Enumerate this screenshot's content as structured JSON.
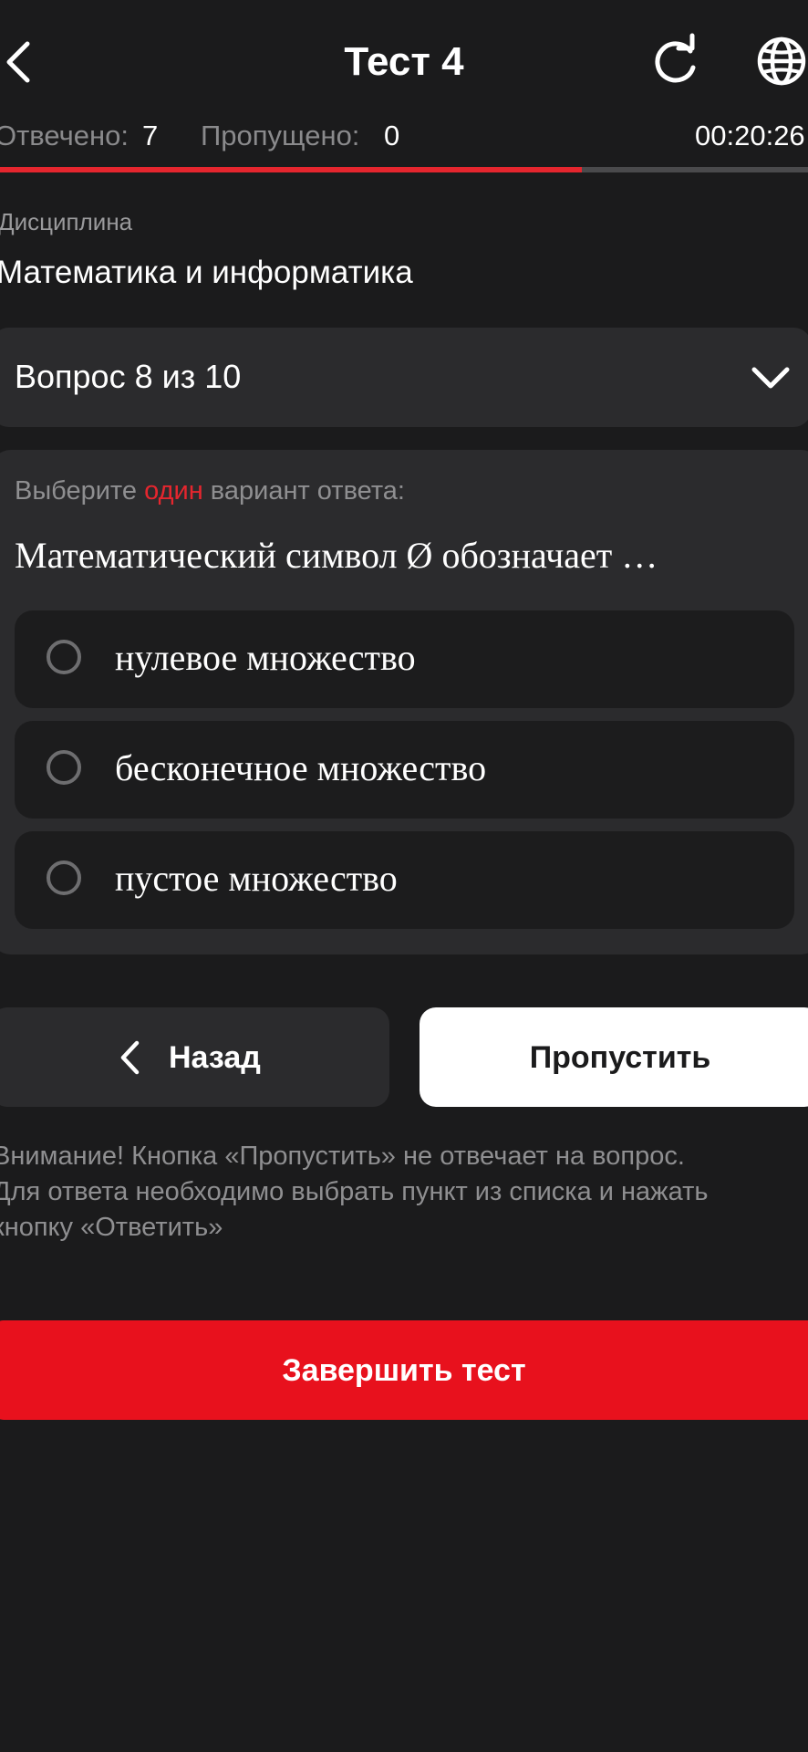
{
  "header": {
    "title": "Тест 4",
    "back_icon": "chevron-left-icon",
    "refresh_icon": "refresh-icon",
    "language_icon": "globe-icon"
  },
  "stats": {
    "answered_label": "Отвечено:",
    "answered_value": "7",
    "skipped_label": "Пропущено:",
    "skipped_value": "0",
    "timer": "00:20:26",
    "progress": 0.72
  },
  "discipline": {
    "label": "Дисциплина",
    "value": "Математика и информатика"
  },
  "question_selector": {
    "label": "Вопрос 8 из 10"
  },
  "question": {
    "instruction_prefix": "Выберите ",
    "instruction_accent": "один",
    "instruction_suffix": " вариант ответа:",
    "text": "Математический символ Ø обозначает …",
    "options": [
      {
        "label": "нулевое множество"
      },
      {
        "label": "бесконечное множество"
      },
      {
        "label": "пустое множество"
      }
    ]
  },
  "buttons": {
    "back_label": "Назад",
    "skip_label": "Пропустить",
    "finish_label": "Завершить тест"
  },
  "notice": {
    "line1": "Внимание! Кнопка «Пропустить» не отвечает на вопрос.",
    "line2": "Для ответа необходимо выбрать пункт из списка и нажать",
    "line3": "кнопку «Ответить»"
  },
  "colors": {
    "background": "#1b1b1c",
    "card": "#2b2b2d",
    "accent": "#e8111d",
    "progress": "#e5262e"
  }
}
